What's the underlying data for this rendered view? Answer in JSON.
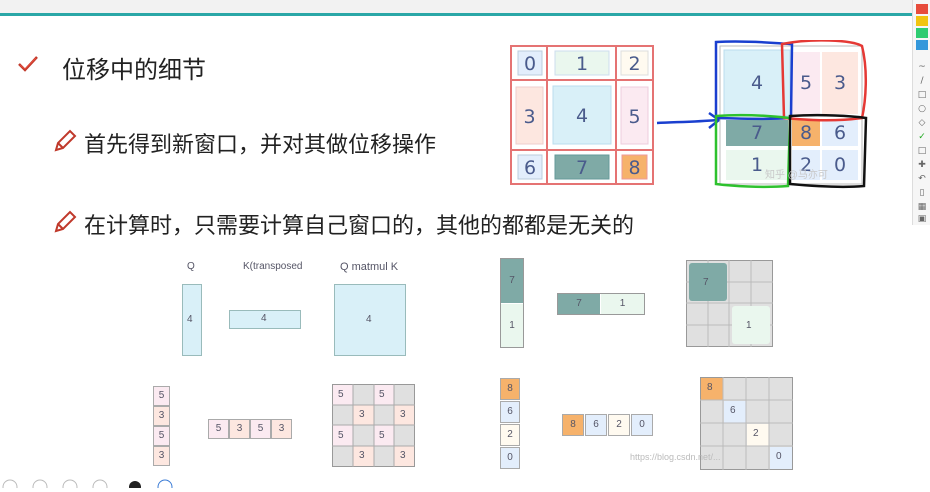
{
  "slide": {
    "title": "位移中的细节",
    "bullet1": "首先得到新窗口，并对其做位移操作",
    "bullet2": "在计算时，只需要计算自己窗口的，其他的都都是无关的"
  },
  "grid_big": [
    "0",
    "1",
    "2",
    "3",
    "4",
    "5",
    "6",
    "7",
    "8"
  ],
  "grid_shift": {
    "tl": "4",
    "tr_a": "5",
    "tr_b": "3",
    "bl_a": "7",
    "bl_b": "1",
    "br_a": "8",
    "br_b": "6",
    "br_c": "2",
    "br_d": "0"
  },
  "mini": {
    "q_label": "Q",
    "kt_label": "K(transposed",
    "qk_label": "Q matmul K",
    "q_val": "4",
    "kt_val": "4",
    "qk_val": "4",
    "col53": [
      "5",
      "3",
      "5",
      "3"
    ],
    "row53": [
      "5",
      "3",
      "5",
      "3"
    ],
    "col71": [
      "7",
      "1"
    ],
    "row71": [
      "7",
      "1"
    ],
    "grid71": [
      "7",
      "1"
    ],
    "col8620": [
      "8",
      "6",
      "2",
      "0"
    ],
    "row8620": [
      "8",
      "6",
      "2",
      "0"
    ],
    "diag8620": [
      "8",
      "6",
      "2",
      "0"
    ],
    "grid53": [
      "5",
      "5",
      "3",
      "3",
      "5",
      "5",
      "3",
      "3"
    ]
  },
  "watermark": "https://blog.csdn.net/...",
  "watermark2": "知乎 @马亦可"
}
